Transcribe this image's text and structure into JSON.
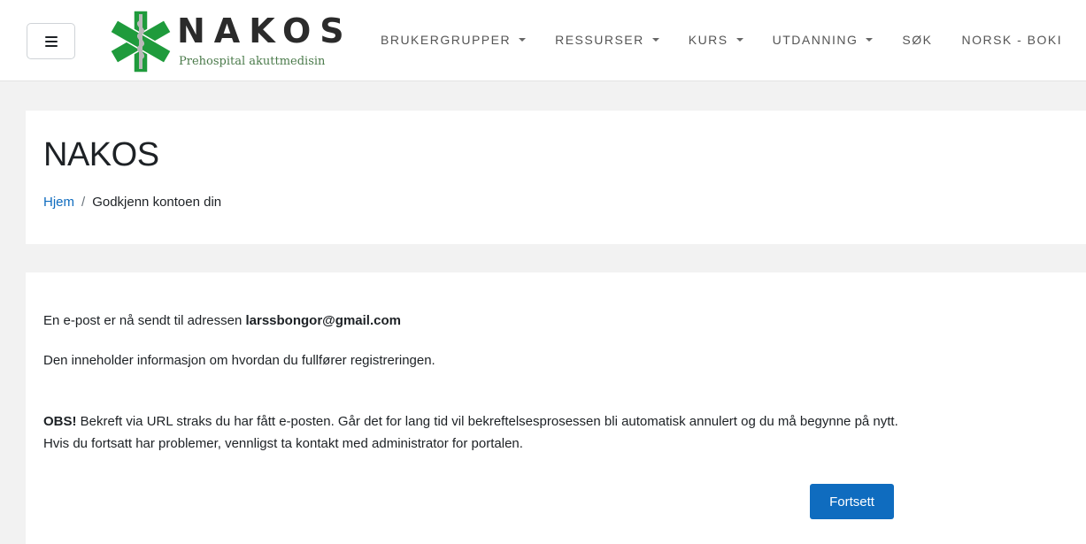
{
  "header": {
    "menu_button": {
      "icon": "hamburger-icon"
    },
    "logo": {
      "wordmark": "NAKOS",
      "tagline": "Prehospital akuttmedisin",
      "colors": {
        "star": "#1f9b3c",
        "staff": "#b9b9b9",
        "text": "#2b2b2b",
        "tagline": "#4a7a4a"
      }
    },
    "nav": [
      {
        "label": "BRUKERGRUPPER",
        "has_dropdown": true
      },
      {
        "label": "RESSURSER",
        "has_dropdown": true
      },
      {
        "label": "KURS",
        "has_dropdown": true
      },
      {
        "label": "UTDANNING",
        "has_dropdown": true
      },
      {
        "label": "SØK",
        "has_dropdown": false
      },
      {
        "label": "NORSK - BOKI",
        "has_dropdown": false
      }
    ]
  },
  "page": {
    "title": "NAKOS",
    "breadcrumb": {
      "home": "Hjem",
      "separator": "/",
      "current": "Godkjenn kontoen din"
    }
  },
  "content": {
    "line1_prefix": "En e-post er nå sendt til adressen ",
    "email": "larssbongor@gmail.com",
    "line2": "Den inneholder informasjon om hvordan du fullfører registreringen.",
    "obs_label": "OBS!",
    "line3": " Bekreft via URL straks du har fått e-posten. Går det for lang tid vil bekreftelsesprosessen bli automatisk annulert og du må begynne på nytt.",
    "line4": "Hvis du fortsatt har problemer, vennligst ta kontakt med administrator for portalen.",
    "continue_button": "Fortsett"
  },
  "colors": {
    "primary": "#0f6cbf",
    "background": "#f2f2f2",
    "card": "#ffffff",
    "text": "#1d2125"
  }
}
